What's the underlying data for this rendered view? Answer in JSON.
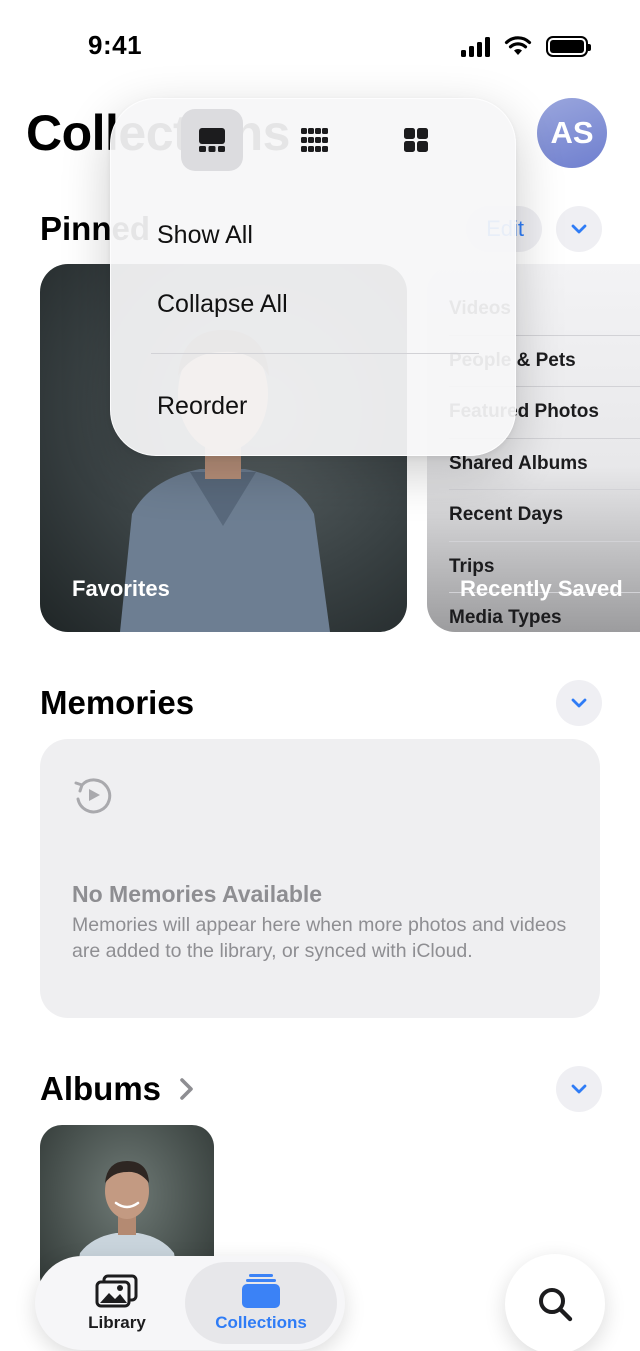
{
  "status_bar": {
    "time": "9:41"
  },
  "header": {
    "title": "Collections",
    "avatar_initials": "AS"
  },
  "pinned": {
    "title": "Pinned",
    "edit_label": "Edit",
    "cards": [
      {
        "label": "Favorites"
      },
      {
        "label": "Recently Saved"
      }
    ],
    "recent_list": [
      "Videos",
      "People & Pets",
      "Featured Photos",
      "Shared Albums",
      "Recent Days",
      "Trips",
      "Media Types"
    ]
  },
  "memories": {
    "title": "Memories",
    "empty_title": "No Memories Available",
    "empty_body": "Memories will appear here when more photos and videos are added to the library, or synced with iCloud."
  },
  "albums": {
    "title": "Albums"
  },
  "tab_bar": {
    "tabs": [
      {
        "label": "Library",
        "selected": false
      },
      {
        "label": "Collections",
        "selected": true
      }
    ]
  },
  "menu": {
    "layout_options": [
      "large-grid-icon",
      "small-grid-icon",
      "medium-grid-icon"
    ],
    "selected_layout": "large-grid-icon",
    "items": [
      "Show All",
      "Collapse All",
      "Reorder"
    ]
  },
  "colors": {
    "accent": "#2f7cf6",
    "avatar": "#7f8dd6",
    "collections_tab_icon": "#3b82f6"
  }
}
